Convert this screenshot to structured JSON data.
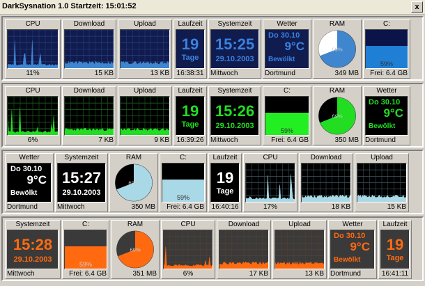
{
  "window": {
    "title": "DarkSysnation 1.0  Startzeit: 15:01:52",
    "close_label": "x"
  },
  "rows": [
    {
      "theme": {
        "bg": "#101b4e",
        "line": "#3f86cf",
        "grid": "#2a3f7e",
        "text": "#3a82e0",
        "pie_bg": "#ffffff",
        "disk_fill": "#1f7fd4",
        "disk_empty": "#0b1449"
      },
      "cpu": {
        "label": "CPU",
        "value": "11%"
      },
      "download": {
        "label": "Download",
        "value": "15 KB"
      },
      "upload": {
        "label": "Upload",
        "value": "13 KB"
      },
      "laufzeit": {
        "label": "Laufzeit",
        "days": "19",
        "unit": "Tage",
        "value": "16:38:31"
      },
      "systemzeit": {
        "label": "Systemzeit",
        "time": "15:25",
        "date": "29.10.2003",
        "day": "Mittwoch"
      },
      "wetter": {
        "label": "Wetter",
        "date": "Do 30.10",
        "temp": "9°C",
        "cond": "Bewölkt",
        "city": "Dortmund"
      },
      "ram": {
        "label": "RAM",
        "percent": 69,
        "pct_text": "69%",
        "value": "349 MB"
      },
      "disk": {
        "label": "C:",
        "percent": 59,
        "pct_text": "59%",
        "value": "Frei: 6.4 GB"
      }
    },
    {
      "theme": {
        "bg": "#000000",
        "line": "#22dd22",
        "grid": "#1f6a1f",
        "text": "#22dd22",
        "pie_bg": "#ffffff",
        "disk_fill": "#22ee22",
        "disk_empty": "#000000"
      },
      "cpu": {
        "label": "CPU",
        "value": "6%"
      },
      "download": {
        "label": "Download",
        "value": "7 KB"
      },
      "upload": {
        "label": "Upload",
        "value": "9 KB"
      },
      "laufzeit": {
        "label": "Laufzeit",
        "days": "19",
        "unit": "Tage",
        "value": "16:39:26"
      },
      "systemzeit": {
        "label": "Systemzeit",
        "time": "15:26",
        "date": "29.10.2003",
        "day": "Mittwoch"
      },
      "wetter": {
        "label": "Wetter",
        "date": "Do 30.10",
        "temp": "9°C",
        "cond": "Bewölkt",
        "city": "Dortmund"
      },
      "ram": {
        "label": "RAM",
        "percent": 69,
        "pct_text": "69%",
        "value": "350 MB"
      },
      "disk": {
        "label": "C:",
        "percent": 59,
        "pct_text": "59%",
        "value": "Frei: 6.4 GB"
      }
    },
    {
      "theme": {
        "bg": "#000000",
        "line": "#a9d8e6",
        "grid": "#3d5660",
        "text": "#ffffff",
        "pie_bg": "#a9d8e6",
        "disk_fill": "#a9d8e6",
        "disk_empty": "#000000"
      },
      "cpu": {
        "label": "CPU",
        "value": "17%"
      },
      "download": {
        "label": "Download",
        "value": "18 KB"
      },
      "upload": {
        "label": "Upload",
        "value": "15 KB"
      },
      "laufzeit": {
        "label": "Laufzeit",
        "days": "19",
        "unit": "Tage",
        "value": "16:40:16"
      },
      "systemzeit": {
        "label": "Systemzeit",
        "time": "15:27",
        "date": "29.10.2003",
        "day": "Mittwoch"
      },
      "wetter": {
        "label": "Wetter",
        "date": "Do 30.10",
        "temp": "9°C",
        "cond": "Bewölkt",
        "city": "Dortmund"
      },
      "ram": {
        "label": "RAM",
        "percent": 69,
        "pct_text": "69%",
        "value": "350 MB"
      },
      "disk": {
        "label": "C:",
        "percent": 59,
        "pct_text": "59%",
        "value": "Frei: 6.4 GB"
      }
    },
    {
      "theme": {
        "bg": "#3a3a3a",
        "line": "#ff6a10",
        "grid": "#5a4030",
        "text": "#ff6a10",
        "pie_bg": "#3a3a3a",
        "disk_fill": "#ff6a10",
        "disk_empty": "#3a3a3a"
      },
      "cpu": {
        "label": "CPU",
        "value": "6%"
      },
      "download": {
        "label": "Download",
        "value": "17 KB"
      },
      "upload": {
        "label": "Upload",
        "value": "13 KB"
      },
      "laufzeit": {
        "label": "Laufzeit",
        "days": "19",
        "unit": "Tage",
        "value": "16:41:11"
      },
      "systemzeit": {
        "label": "Systemzeit",
        "time": "15:28",
        "date": "29.10.2003",
        "day": "Mittwoch"
      },
      "wetter": {
        "label": "Wetter",
        "date": "Do 30.10",
        "temp": "9°C",
        "cond": "Bewölkt",
        "city": "Dortmund"
      },
      "ram": {
        "label": "RAM",
        "percent": 69,
        "pct_text": "69%",
        "value": "351 MB"
      },
      "disk": {
        "label": "C:",
        "percent": 59,
        "pct_text": "59%",
        "value": "Frei: 6.4 GB"
      }
    }
  ]
}
